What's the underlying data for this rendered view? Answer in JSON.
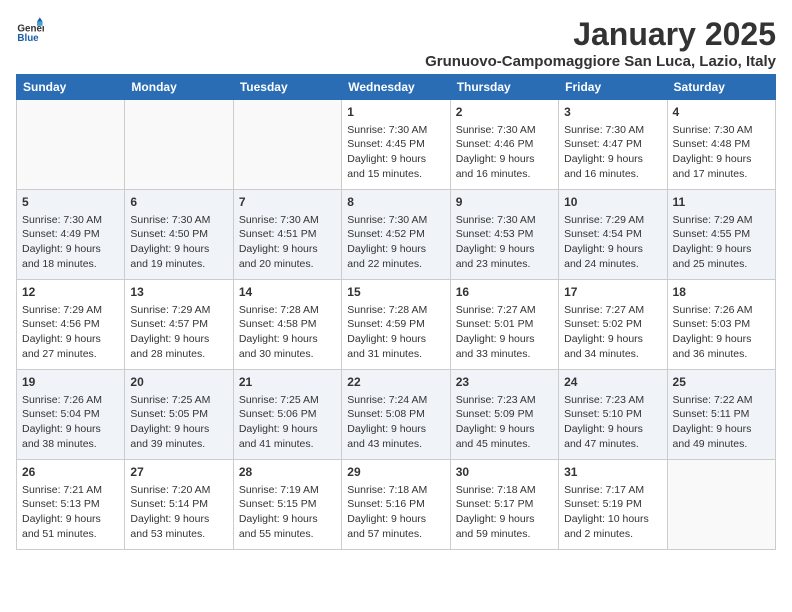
{
  "logo": {
    "line1": "General",
    "line2": "Blue"
  },
  "title": "January 2025",
  "subtitle": "Grunuovo-Campomaggiore San Luca, Lazio, Italy",
  "days_of_week": [
    "Sunday",
    "Monday",
    "Tuesday",
    "Wednesday",
    "Thursday",
    "Friday",
    "Saturday"
  ],
  "weeks": [
    [
      {
        "day": "",
        "info": ""
      },
      {
        "day": "",
        "info": ""
      },
      {
        "day": "",
        "info": ""
      },
      {
        "day": "1",
        "info": "Sunrise: 7:30 AM\nSunset: 4:45 PM\nDaylight: 9 hours and 15 minutes."
      },
      {
        "day": "2",
        "info": "Sunrise: 7:30 AM\nSunset: 4:46 PM\nDaylight: 9 hours and 16 minutes."
      },
      {
        "day": "3",
        "info": "Sunrise: 7:30 AM\nSunset: 4:47 PM\nDaylight: 9 hours and 16 minutes."
      },
      {
        "day": "4",
        "info": "Sunrise: 7:30 AM\nSunset: 4:48 PM\nDaylight: 9 hours and 17 minutes."
      }
    ],
    [
      {
        "day": "5",
        "info": "Sunrise: 7:30 AM\nSunset: 4:49 PM\nDaylight: 9 hours and 18 minutes."
      },
      {
        "day": "6",
        "info": "Sunrise: 7:30 AM\nSunset: 4:50 PM\nDaylight: 9 hours and 19 minutes."
      },
      {
        "day": "7",
        "info": "Sunrise: 7:30 AM\nSunset: 4:51 PM\nDaylight: 9 hours and 20 minutes."
      },
      {
        "day": "8",
        "info": "Sunrise: 7:30 AM\nSunset: 4:52 PM\nDaylight: 9 hours and 22 minutes."
      },
      {
        "day": "9",
        "info": "Sunrise: 7:30 AM\nSunset: 4:53 PM\nDaylight: 9 hours and 23 minutes."
      },
      {
        "day": "10",
        "info": "Sunrise: 7:29 AM\nSunset: 4:54 PM\nDaylight: 9 hours and 24 minutes."
      },
      {
        "day": "11",
        "info": "Sunrise: 7:29 AM\nSunset: 4:55 PM\nDaylight: 9 hours and 25 minutes."
      }
    ],
    [
      {
        "day": "12",
        "info": "Sunrise: 7:29 AM\nSunset: 4:56 PM\nDaylight: 9 hours and 27 minutes."
      },
      {
        "day": "13",
        "info": "Sunrise: 7:29 AM\nSunset: 4:57 PM\nDaylight: 9 hours and 28 minutes."
      },
      {
        "day": "14",
        "info": "Sunrise: 7:28 AM\nSunset: 4:58 PM\nDaylight: 9 hours and 30 minutes."
      },
      {
        "day": "15",
        "info": "Sunrise: 7:28 AM\nSunset: 4:59 PM\nDaylight: 9 hours and 31 minutes."
      },
      {
        "day": "16",
        "info": "Sunrise: 7:27 AM\nSunset: 5:01 PM\nDaylight: 9 hours and 33 minutes."
      },
      {
        "day": "17",
        "info": "Sunrise: 7:27 AM\nSunset: 5:02 PM\nDaylight: 9 hours and 34 minutes."
      },
      {
        "day": "18",
        "info": "Sunrise: 7:26 AM\nSunset: 5:03 PM\nDaylight: 9 hours and 36 minutes."
      }
    ],
    [
      {
        "day": "19",
        "info": "Sunrise: 7:26 AM\nSunset: 5:04 PM\nDaylight: 9 hours and 38 minutes."
      },
      {
        "day": "20",
        "info": "Sunrise: 7:25 AM\nSunset: 5:05 PM\nDaylight: 9 hours and 39 minutes."
      },
      {
        "day": "21",
        "info": "Sunrise: 7:25 AM\nSunset: 5:06 PM\nDaylight: 9 hours and 41 minutes."
      },
      {
        "day": "22",
        "info": "Sunrise: 7:24 AM\nSunset: 5:08 PM\nDaylight: 9 hours and 43 minutes."
      },
      {
        "day": "23",
        "info": "Sunrise: 7:23 AM\nSunset: 5:09 PM\nDaylight: 9 hours and 45 minutes."
      },
      {
        "day": "24",
        "info": "Sunrise: 7:23 AM\nSunset: 5:10 PM\nDaylight: 9 hours and 47 minutes."
      },
      {
        "day": "25",
        "info": "Sunrise: 7:22 AM\nSunset: 5:11 PM\nDaylight: 9 hours and 49 minutes."
      }
    ],
    [
      {
        "day": "26",
        "info": "Sunrise: 7:21 AM\nSunset: 5:13 PM\nDaylight: 9 hours and 51 minutes."
      },
      {
        "day": "27",
        "info": "Sunrise: 7:20 AM\nSunset: 5:14 PM\nDaylight: 9 hours and 53 minutes."
      },
      {
        "day": "28",
        "info": "Sunrise: 7:19 AM\nSunset: 5:15 PM\nDaylight: 9 hours and 55 minutes."
      },
      {
        "day": "29",
        "info": "Sunrise: 7:18 AM\nSunset: 5:16 PM\nDaylight: 9 hours and 57 minutes."
      },
      {
        "day": "30",
        "info": "Sunrise: 7:18 AM\nSunset: 5:17 PM\nDaylight: 9 hours and 59 minutes."
      },
      {
        "day": "31",
        "info": "Sunrise: 7:17 AM\nSunset: 5:19 PM\nDaylight: 10 hours and 2 minutes."
      },
      {
        "day": "",
        "info": ""
      }
    ]
  ]
}
